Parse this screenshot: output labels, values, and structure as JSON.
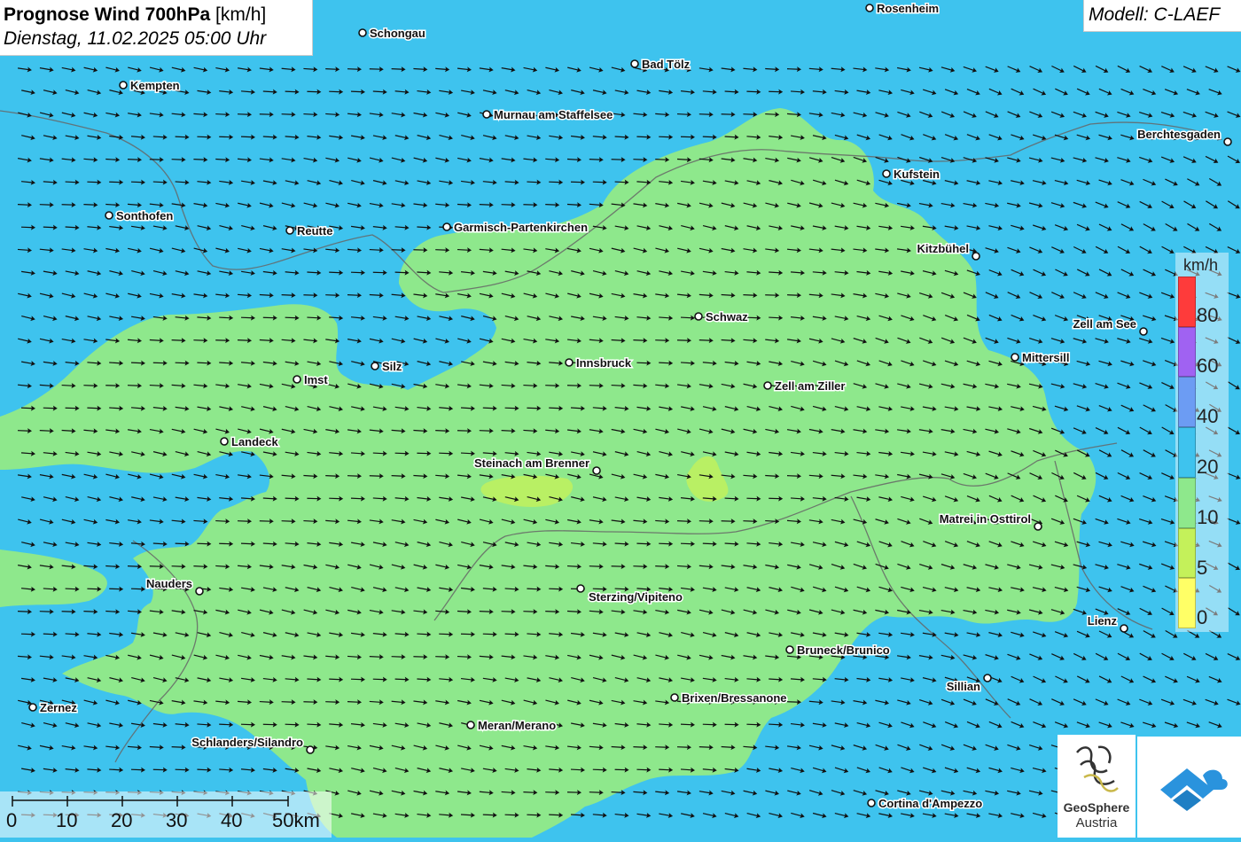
{
  "header": {
    "title_bold": "Prognose Wind 700hPa",
    "title_unit": "[km/h]",
    "datetime": "Dienstag, 11.02.2025 05:00 Uhr",
    "model": "Modell: C-LAEF"
  },
  "legend": {
    "unit": "km/h",
    "levels": [
      {
        "label": "80",
        "color": "#fe3b3b"
      },
      {
        "label": "60",
        "color": "#a062f2"
      },
      {
        "label": "40",
        "color": "#6c9cf3"
      },
      {
        "label": "20",
        "color": "#3ec3ee"
      },
      {
        "label": "10",
        "color": "#8ee88c"
      },
      {
        "label": "5",
        "color": "#c4f15a"
      },
      {
        "label": "0",
        "color": "#ffff66"
      }
    ]
  },
  "scale": {
    "labels": [
      "0",
      "10",
      "20",
      "30",
      "40",
      "50km"
    ]
  },
  "logos": {
    "geosphere_line1": "GeoSphere",
    "geosphere_line2": "Austria"
  },
  "cities": [
    {
      "name": "Rosenheim"
    },
    {
      "name": "Schongau"
    },
    {
      "name": "Bad Tölz"
    },
    {
      "name": "Kempten"
    },
    {
      "name": "Murnau am Staffelsee"
    },
    {
      "name": "Berchtesgaden"
    },
    {
      "name": "Kufstein"
    },
    {
      "name": "Sonthofen"
    },
    {
      "name": "Reutte"
    },
    {
      "name": "Garmisch-Partenkirchen"
    },
    {
      "name": "Kitzbühel"
    },
    {
      "name": "Schwaz"
    },
    {
      "name": "Zell am See"
    },
    {
      "name": "Mittersill"
    },
    {
      "name": "Silz"
    },
    {
      "name": "Innsbruck"
    },
    {
      "name": "Imst"
    },
    {
      "name": "Zell am Ziller"
    },
    {
      "name": "Landeck"
    },
    {
      "name": "Steinach am Brenner"
    },
    {
      "name": "Matrei in Osttirol"
    },
    {
      "name": "Nauders"
    },
    {
      "name": "Sterzing/Vipiteno"
    },
    {
      "name": "Lienz"
    },
    {
      "name": "Bruneck/Brunico"
    },
    {
      "name": "Sillian"
    },
    {
      "name": "Brixen/Bressanone"
    },
    {
      "name": "Zernez"
    },
    {
      "name": "Meran/Merano"
    },
    {
      "name": "Schlanders/Silandro"
    },
    {
      "name": "Cortina d'Ampezzo"
    }
  ]
}
